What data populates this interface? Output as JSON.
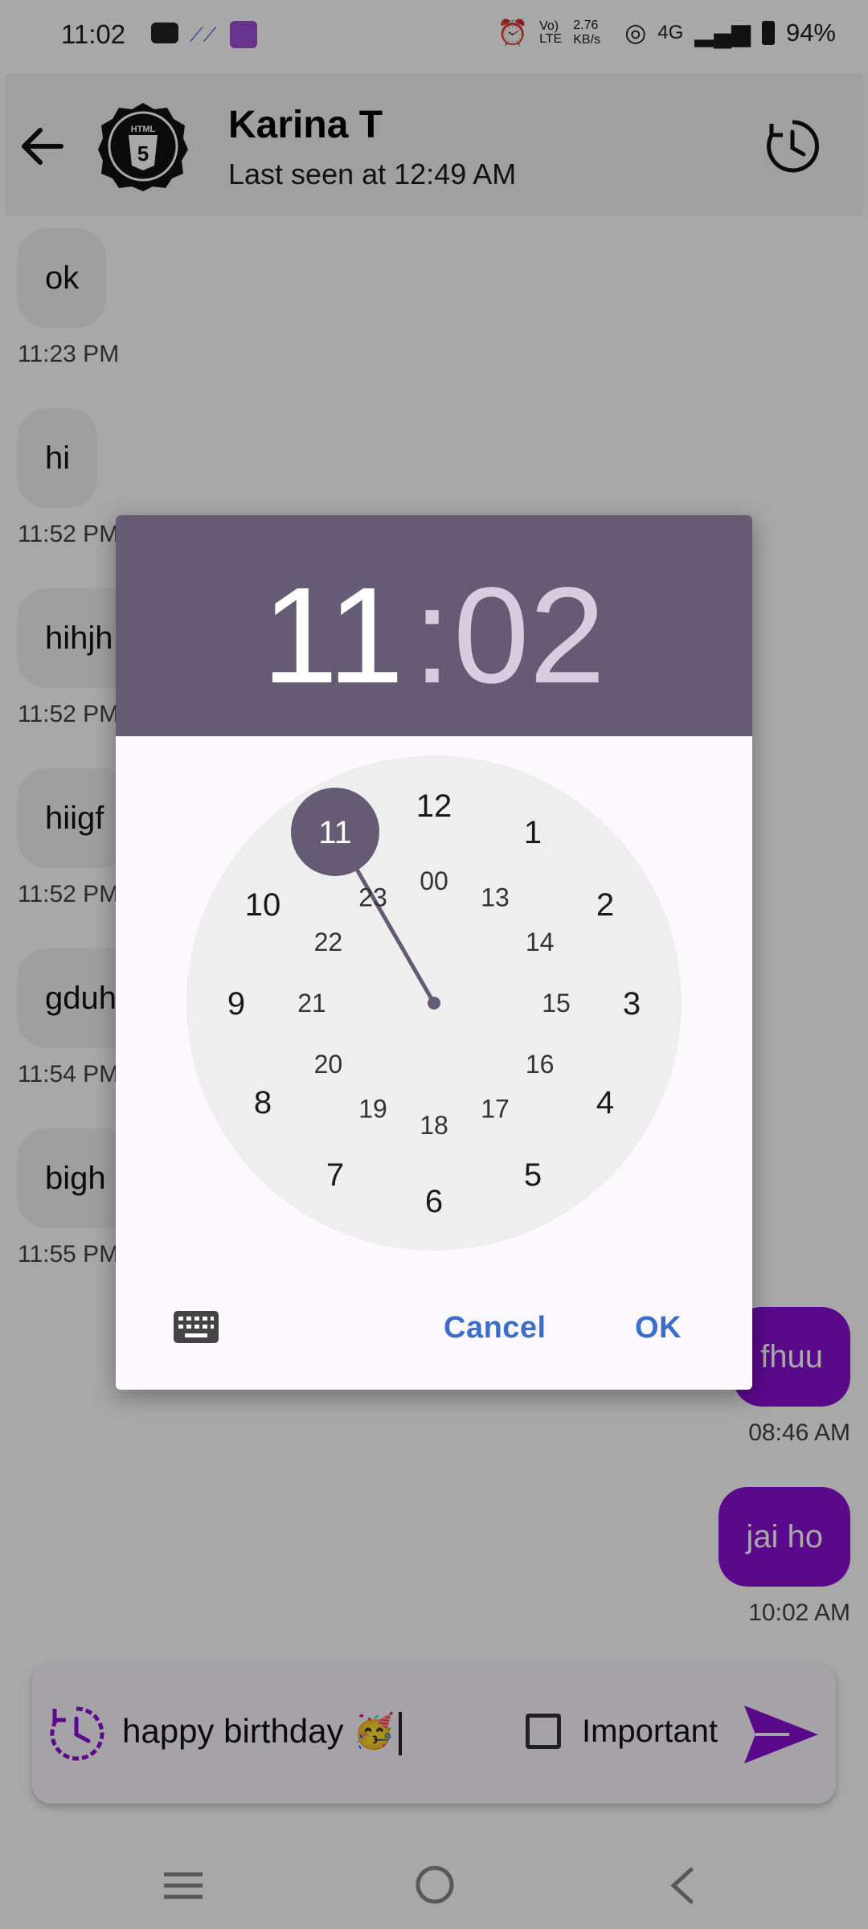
{
  "status_bar": {
    "time": "11:02",
    "network": "4G",
    "speed": "2.76\nKB/s",
    "battery": "94%"
  },
  "header": {
    "contact_name": "Karina T",
    "last_seen": "Last seen at 12:49 AM"
  },
  "messages_in": [
    {
      "text": "ok",
      "time": "11:23 PM"
    },
    {
      "text": "hi",
      "time": "11:52 PM"
    },
    {
      "text": "hihjh",
      "time": "11:52 PM"
    },
    {
      "text": "hiigf",
      "time": "11:52 PM"
    },
    {
      "text": "gduh",
      "time": "11:54 PM"
    },
    {
      "text": "bigh",
      "time": "11:55 PM"
    }
  ],
  "messages_out": [
    {
      "text": "fhuu",
      "time": "08:46 AM"
    },
    {
      "text": "jai ho",
      "time": "10:02 AM"
    }
  ],
  "compose": {
    "text": "happy birthday 🥳",
    "important_label": "Important"
  },
  "dialog": {
    "hour": "11",
    "colon": ":",
    "minute": "02",
    "outer_numbers": [
      "12",
      "1",
      "2",
      "3",
      "4",
      "5",
      "6",
      "7",
      "8",
      "9",
      "10",
      "11"
    ],
    "inner_numbers": [
      "00",
      "13",
      "14",
      "15",
      "16",
      "17",
      "18",
      "19",
      "20",
      "21",
      "22",
      "23"
    ],
    "selected_hour": "11",
    "cancel_label": "Cancel",
    "ok_label": "OK"
  },
  "colors": {
    "accent_purple": "#8a0fd4",
    "dialog_header": "#655b75",
    "button_blue": "#3a6ecb"
  },
  "icons": [
    "back-arrow-icon",
    "html5-avatar-icon",
    "schedule-clock-icon",
    "keyboard-icon",
    "send-icon",
    "home-icon",
    "menu-icon",
    "back-nav-icon"
  ]
}
